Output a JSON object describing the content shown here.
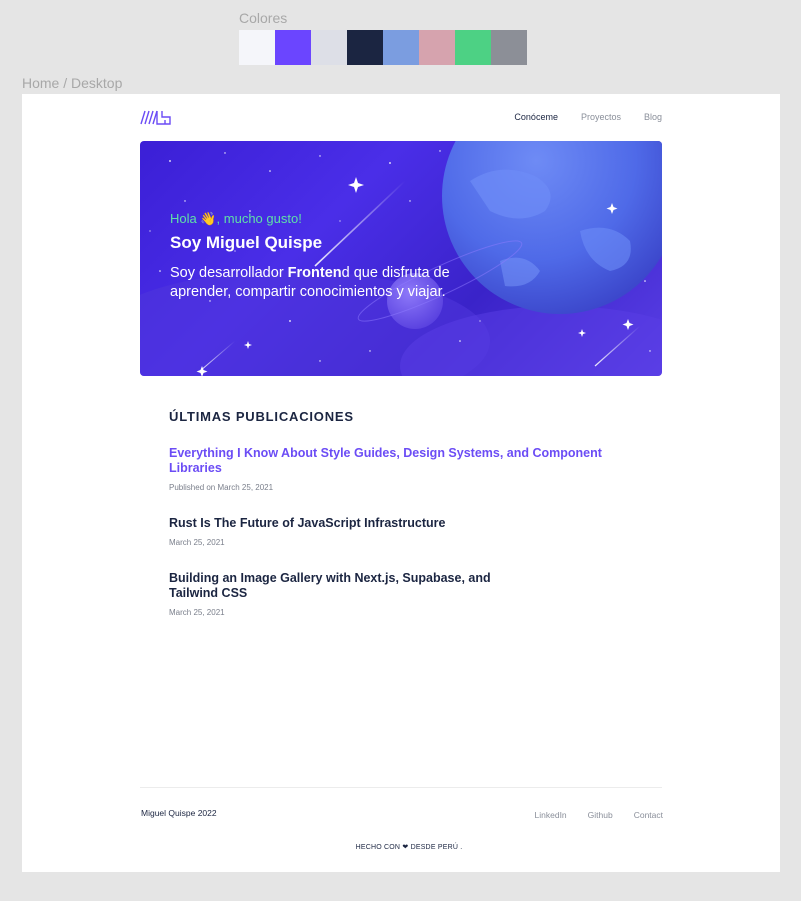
{
  "canvas": {
    "colors_label": "Colores",
    "frame_label": "Home / Desktop",
    "swatches": [
      {
        "color": "#f5f6fa"
      },
      {
        "color": "#6b45ff"
      },
      {
        "color": "#dddfe7"
      },
      {
        "color": "#1b2541"
      },
      {
        "color": "#7b9de0"
      },
      {
        "color": "#d6a3ae"
      },
      {
        "color": "#4dd184"
      },
      {
        "color": "#8c8f97"
      }
    ]
  },
  "nav": {
    "logo_icon": "logo-mq-icon",
    "links": [
      "Conóceme",
      "Proyectos",
      "Blog"
    ],
    "active_index": 0
  },
  "hero": {
    "greeting_pre": "Hola ",
    "greeting_emoji": "👋",
    "greeting_post": ", mucho gusto!",
    "title": "Soy Miguel Quispe",
    "desc_pre": "Soy desarrollador ",
    "desc_bold": "Fronten",
    "desc_post": "d que disfruta de aprender, compartir conocimientos y viajar."
  },
  "posts": {
    "section_title": "ÚLTIMAS PUBLICACIONES",
    "items": [
      {
        "title": "Everything I Know About Style Guides, Design Systems, and Component Libraries",
        "date": "Published on March 25, 2021"
      },
      {
        "title": "Rust Is The Future of JavaScript Infrastructure",
        "date": "March 25, 2021"
      },
      {
        "title": "Building an Image Gallery with Next.js, Supabase, and Tailwind CSS",
        "date": "March 25, 2021"
      }
    ]
  },
  "footer": {
    "name": "Miguel Quispe 2022",
    "links": [
      "LinkedIn",
      "Github",
      "Contact"
    ],
    "made_pre": "HECHO CON ",
    "made_heart": "❤",
    "made_post": " DESDE PERÚ ."
  },
  "colors": {
    "accent": "#6b4cf5",
    "dark": "#1b2541",
    "greeting": "#5fe0a8"
  }
}
